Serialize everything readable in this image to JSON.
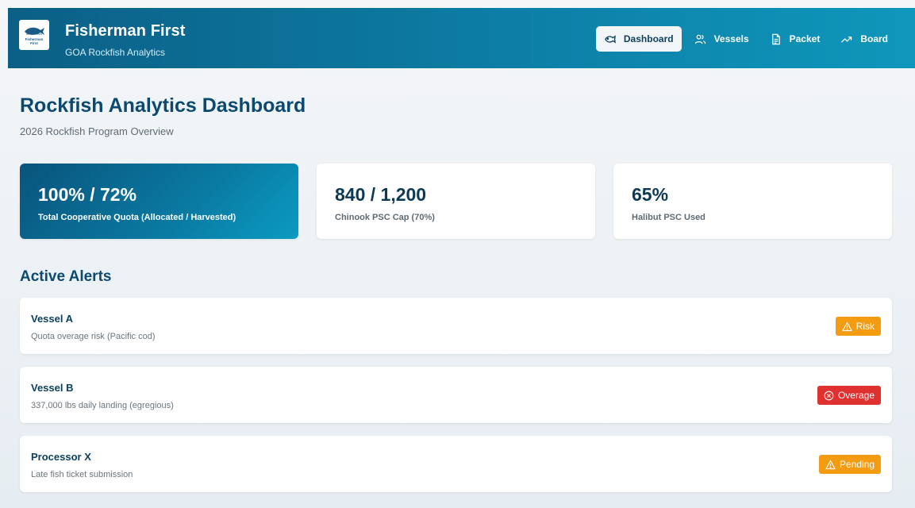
{
  "header": {
    "logo_text_line1": "Fisherman",
    "logo_text_line2": "First",
    "title": "Fisherman First",
    "subtitle": "GOA Rockfish Analytics",
    "nav": [
      {
        "label": "Dashboard",
        "icon": "fish-icon",
        "active": true
      },
      {
        "label": "Vessels",
        "icon": "users-icon",
        "active": false
      },
      {
        "label": "Packet",
        "icon": "document-icon",
        "active": false
      },
      {
        "label": "Board",
        "icon": "trending-up-icon",
        "active": false
      }
    ]
  },
  "page": {
    "title": "Rockfish Analytics Dashboard",
    "subtitle": "2026 Rockfish Program Overview"
  },
  "stats": [
    {
      "value": "100% / 72%",
      "label": "Total Cooperative Quota (Allocated / Harvested)"
    },
    {
      "value": "840 / 1,200",
      "label": "Chinook PSC Cap (70%)"
    },
    {
      "value": "65%",
      "label": "Halibut PSC Used"
    }
  ],
  "alerts_section": {
    "title": "Active Alerts",
    "items": [
      {
        "name": "Vessel A",
        "description": "Quota overage risk (Pacific cod)",
        "badge": "Risk",
        "badge_color": "#f39c12",
        "badge_icon": "warning-icon"
      },
      {
        "name": "Vessel B",
        "description": "337,000 lbs daily landing (egregious)",
        "badge": "Overage",
        "badge_color": "#e03131",
        "badge_icon": "x-circle-icon"
      },
      {
        "name": "Processor X",
        "description": "Late fish ticket submission",
        "badge": "Pending",
        "badge_color": "#f39c12",
        "badge_icon": "warning-icon"
      }
    ]
  },
  "colors": {
    "header_start": "#0b5f86",
    "header_end": "#0f97bb",
    "heading": "#0b4a6e",
    "risk": "#f39c12",
    "overage": "#e03131"
  }
}
